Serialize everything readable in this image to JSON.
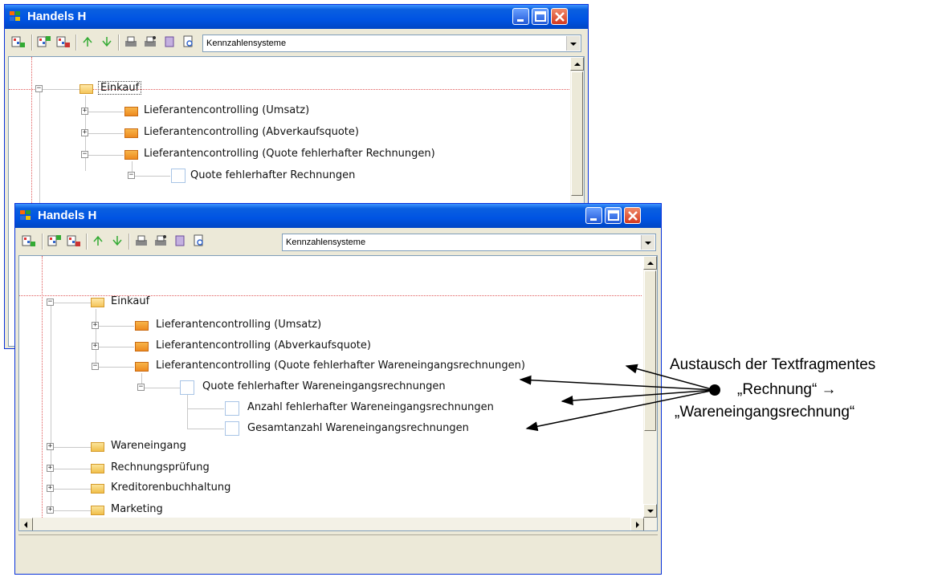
{
  "window_back": {
    "title": "Handels H",
    "combo_value": "Kennzahlensysteme",
    "tree": {
      "root": "Einkauf",
      "children": [
        "Lieferantencontrolling (Umsatz)",
        "Lieferantencontrolling (Abverkaufsquote)",
        "Lieferantencontrolling (Quote fehlerhafter Rechnungen)"
      ],
      "leaf": "Quote fehlerhafter Rechnungen"
    }
  },
  "window_front": {
    "title": "Handels H",
    "combo_value": "Kennzahlensysteme",
    "tree": {
      "root": "Einkauf",
      "children": [
        "Lieferantencontrolling (Umsatz)",
        "Lieferantencontrolling (Abverkaufsquote)",
        "Lieferantencontrolling (Quote fehlerhafter Wareneingangsrechnungen)"
      ],
      "leaf": "Quote fehlerhafter Wareneingangsrechnungen",
      "subleaves": [
        "Anzahl fehlerhafter Wareneingangsrechnungen",
        "Gesamtanzahl Wareneingangsrechnungen"
      ],
      "siblings": [
        "Wareneingang",
        "Rechnungsprüfung",
        "Kreditorenbuchhaltung",
        "Marketing"
      ]
    }
  },
  "annotation": {
    "line1": "Austausch der Textfragmentes",
    "line2": "„Rechnung“ →",
    "line3": "„Wareneingangsrechnung“"
  },
  "colors": {
    "title_blue": "#0054e3",
    "folder_orange": "#ee8a1f",
    "guide_red": "#e05a5a"
  }
}
